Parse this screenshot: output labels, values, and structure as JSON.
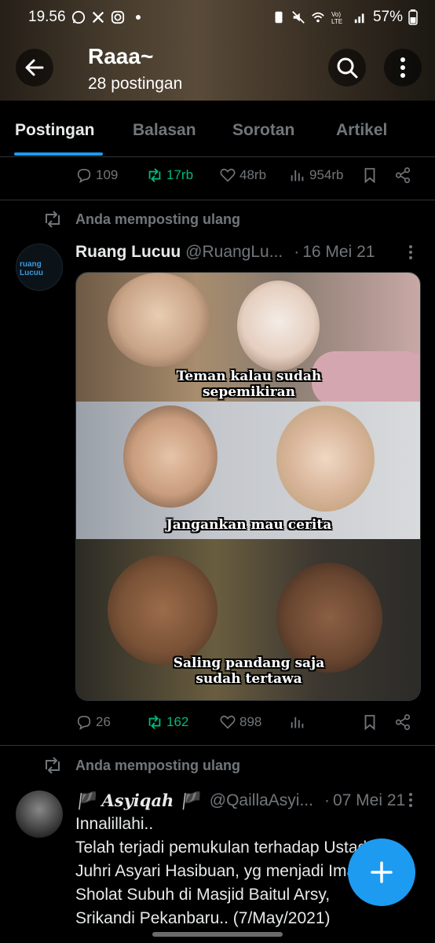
{
  "status_bar": {
    "time": "19.56",
    "icons_left": [
      "whatsapp-icon",
      "x-icon",
      "instagram-icon",
      "dot"
    ],
    "icons_right": [
      "battery-saver-icon",
      "mute-icon",
      "wifi-icon",
      "volte-icon",
      "signal-icon"
    ],
    "battery": "57%"
  },
  "header": {
    "title": "Raaa~",
    "subtitle": "28 postingan"
  },
  "tabs": [
    {
      "label": "Postingan",
      "active": true
    },
    {
      "label": "Balasan",
      "active": false
    },
    {
      "label": "Sorotan",
      "active": false
    },
    {
      "label": "Artikel",
      "active": false
    }
  ],
  "post0": {
    "replies": "109",
    "reposts": "17rb",
    "likes": "48rb",
    "views": "954rb"
  },
  "post1": {
    "repost_label": "Anda memposting ulang",
    "name": "Ruang Lucuu",
    "handle": "@RuangLu...",
    "date": "16 Mei 21",
    "avatar_text_1": "ruang",
    "avatar_text_2": "Lucuu",
    "captions": {
      "panel1_line1": "Teman kalau sudah",
      "panel1_line2": "sepemikiran",
      "panel2_line1": "Jangankan mau cerita",
      "panel3_line1": "Saling pandang saja",
      "panel3_line2": "sudah tertawa"
    },
    "replies": "26",
    "reposts": "162",
    "likes": "898",
    "views": ""
  },
  "post2": {
    "repost_label": "Anda memposting ulang",
    "name": "🏴 Asyiqah 🏴",
    "handle": "@QaillaAsyi...",
    "date": "07 Mei 21",
    "text_lines": [
      "Innalillahi..",
      "Telah terjadi pemukulan terhadap Ustadz",
      "Juhri Asyari Hasibuan, yg menjadi Imam",
      "Sholat Subuh di Masjid Baitul Arsy,",
      "Srikandi Pekanbaru.. (7/May/2021)"
    ]
  },
  "colors": {
    "accent": "#1d9bf0",
    "repost_green": "#00ba7c",
    "muted": "#71767b",
    "divider": "#2f3336"
  }
}
